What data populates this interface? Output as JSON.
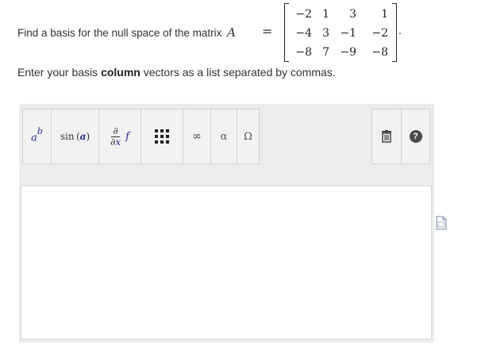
{
  "question": {
    "prompt": "Find a basis for the null space of the matrix",
    "variable": "A",
    "equals": "=",
    "matrix_rows": [
      [
        "−2",
        "1",
        "3",
        "1"
      ],
      [
        "−4",
        "3",
        "−1",
        "−2"
      ],
      [
        "−8",
        "7",
        "−9",
        "−8"
      ]
    ],
    "end_period": ".",
    "instruction_before": "Enter your basis ",
    "instruction_bold": "column",
    "instruction_after": " vectors as a list separated by commas."
  },
  "toolbar": {
    "power": {
      "base": "a",
      "exp": "b",
      "icon": "superscript-icon"
    },
    "sin": {
      "func": "sin",
      "open": "(",
      "arg": "a",
      "close": ")"
    },
    "derivative": {
      "numerator": "∂",
      "denominator_d": "∂",
      "denominator_x": "x",
      "func": "f",
      "icon": "partial-derivative-icon"
    },
    "matrix": {
      "icon": "matrix-icon"
    },
    "infinity": {
      "symbol": "∞"
    },
    "alpha": {
      "symbol": "α"
    },
    "omega": {
      "symbol": "Ω"
    },
    "trash": {
      "icon": "trash-icon"
    },
    "help": {
      "symbol": "?",
      "icon": "help-icon"
    }
  },
  "answer": {
    "value": ""
  },
  "side": {
    "icon": "document-icon"
  },
  "colors": {
    "panel": "#ececec",
    "button": "#f2f2f2",
    "variable": "#23298a"
  }
}
